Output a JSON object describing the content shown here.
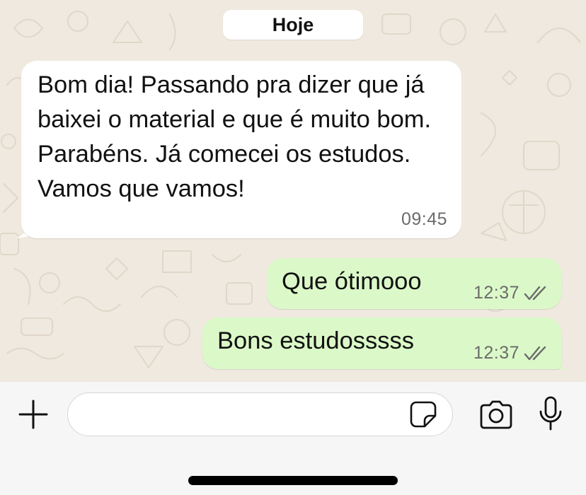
{
  "chat": {
    "date_label": "Hoje",
    "messages": [
      {
        "direction": "incoming",
        "text": "Bom dia! Passando pra dizer que já baixei o material e que é muito bom. Parabéns. Já comecei os estudos. Vamos que vamos!",
        "time": "09:45"
      },
      {
        "direction": "outgoing",
        "text": "Que ótimooo",
        "time": "12:37",
        "status_icon": "double-check-icon"
      },
      {
        "direction": "outgoing",
        "text": "Bons estudosssss",
        "time": "12:37",
        "status_icon": "double-check-icon"
      }
    ]
  },
  "input_bar": {
    "placeholder": "",
    "value": "",
    "icons": [
      "plus-icon",
      "sticker-icon",
      "camera-icon",
      "microphone-icon"
    ]
  },
  "colors": {
    "wallpaper": "#efe9df",
    "incoming_bubble": "#ffffff",
    "outgoing_bubble": "#dbf9c8",
    "timestamp": "#6b6b6b",
    "input_bar_bg": "#f6f6f6"
  }
}
